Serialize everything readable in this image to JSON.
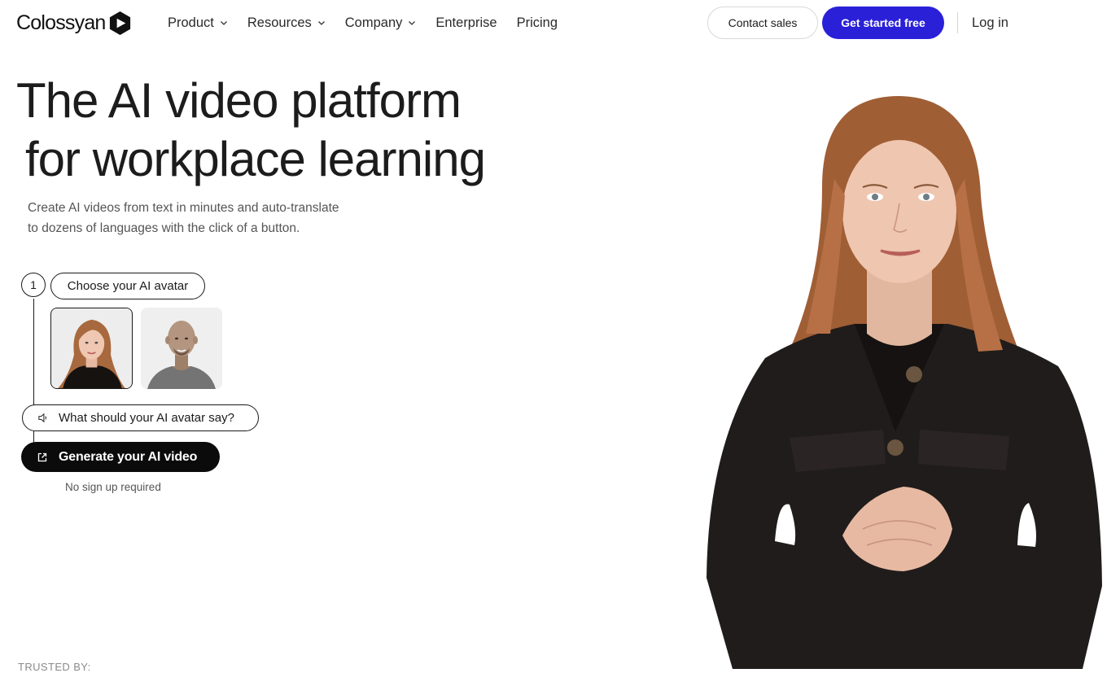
{
  "nav": {
    "logo_text": "Colossyan",
    "items": [
      {
        "label": "Product",
        "has_dropdown": true
      },
      {
        "label": "Resources",
        "has_dropdown": true
      },
      {
        "label": "Company",
        "has_dropdown": true
      },
      {
        "label": "Enterprise",
        "has_dropdown": false
      },
      {
        "label": "Pricing",
        "has_dropdown": false
      }
    ],
    "contact_sales": "Contact sales",
    "get_started": "Get started free",
    "login": "Log in"
  },
  "hero": {
    "title_line1": "The AI video platform",
    "title_line2": "for workplace learning",
    "subtitle_line1": "Create AI videos from text in minutes and auto-translate",
    "subtitle_line2": "to dozens of languages with the click of a button."
  },
  "steps": {
    "step_number": "1",
    "choose_label": "Choose your AI avatar",
    "avatars": [
      {
        "name": "female-avatar",
        "selected": true
      },
      {
        "name": "male-avatar",
        "selected": false
      }
    ],
    "say_placeholder": "What should your AI avatar say?",
    "generate_label": "Generate your AI video",
    "no_signup": "No sign up required"
  },
  "trusted_label": "TRUSTED BY:",
  "colors": {
    "accent": "#2a20d8",
    "text": "#1c1c1c",
    "muted": "#555555",
    "button_dark": "#0b0b0b"
  },
  "icons": [
    "chevron-down-icon",
    "speaker-icon",
    "external-link-icon",
    "play-logo-icon"
  ]
}
